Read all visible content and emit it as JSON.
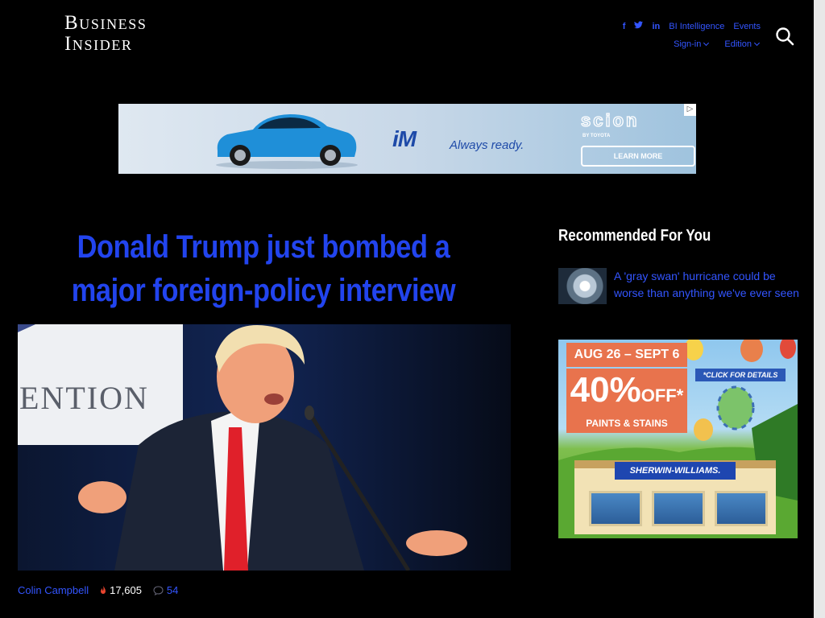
{
  "header": {
    "logo_line1": "Business",
    "logo_line2": "Insider",
    "social": [
      "f",
      "t",
      "in"
    ],
    "links": {
      "bi_intelligence": "BI Intelligence",
      "events": "Events",
      "sign_in": "Sign-in",
      "edition": "Edition"
    },
    "icons": {
      "search": "search-icon"
    }
  },
  "banner_ad": {
    "model": "iM",
    "slogan": "Always ready.",
    "brand": "scion",
    "brand_sub": "BY TOYOTA",
    "cta": "LEARN MORE",
    "ad_choice": "▷"
  },
  "article": {
    "headline": "Donald Trump just bombed a major foreign-policy interview",
    "hero_sign_text": "ENTION",
    "author": "Colin Campbell",
    "views": "17,605",
    "comments": "54"
  },
  "sidebar": {
    "title": "Recommended For You",
    "items": [
      {
        "title": "A 'gray swan' hurricane could be worse than anything we've ever seen"
      }
    ],
    "ad": {
      "dates": "AUG 26 – SEPT 6",
      "percent": "40%",
      "off": "OFF*",
      "products": "PAINTS & STAINS",
      "click": "*CLICK FOR DETAILS",
      "store": "SHERWIN-WILLIAMS."
    }
  },
  "colors": {
    "link": "#3355ff",
    "headline": "#2244ee",
    "background": "#000000"
  }
}
